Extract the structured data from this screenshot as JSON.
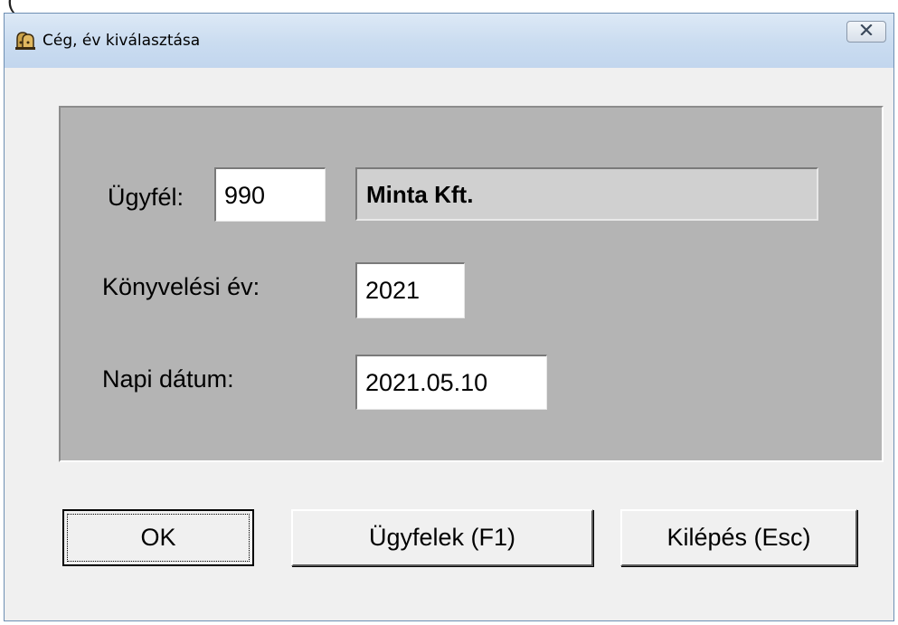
{
  "window": {
    "title": "Cég, év kiválasztása",
    "icon": "app-bell-icon",
    "close_icon": "close-icon"
  },
  "background_text": "(",
  "form": {
    "client_label": "Ügyfél:",
    "client_code": "990",
    "client_name": "Minta Kft.",
    "year_label": "Könyvelési év:",
    "year_value": "2021",
    "date_label": "Napi dátum:",
    "date_value": "2021.05.10"
  },
  "buttons": {
    "ok": "OK",
    "clients": "Ügyfelek (F1)",
    "exit": "Kilépés (Esc)"
  },
  "colors": {
    "panel": "#b4b4b4",
    "name_field": "#d0d0d0",
    "titlebar": "#cadcf0",
    "client_area": "#f0f0f0"
  }
}
